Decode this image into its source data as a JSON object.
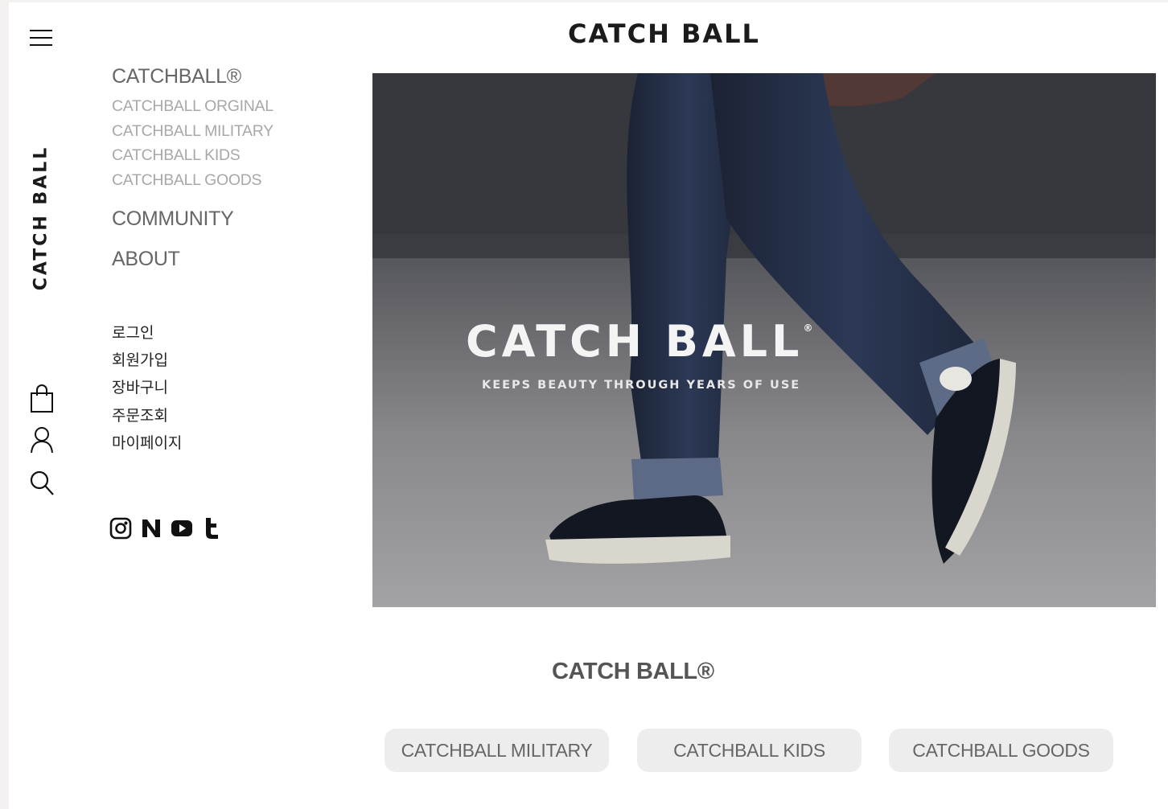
{
  "header": {
    "brand": "CATCH BALL"
  },
  "rail": {
    "logo_text": "CATCH BALL",
    "icons": [
      "menu-icon",
      "shopping-bag-icon",
      "user-icon",
      "search-icon"
    ]
  },
  "menu": {
    "category_title": "CATCHBALL®",
    "sub_items": [
      "CATCHBALL ORGINAL",
      "CATCHBALL MILITARY",
      "CATCHBALL KIDS",
      "CATCHBALL GOODS"
    ],
    "community": "COMMUNITY",
    "about": "ABOUT",
    "account_items": [
      "로그인",
      "회원가입",
      "장바구니",
      "주문조회",
      "마이페이지"
    ],
    "socials": [
      "instagram-icon",
      "naver-blog-icon",
      "youtube-icon",
      "tumblr-icon"
    ]
  },
  "hero": {
    "logo": "CATCH BALL",
    "registered_mark": "®",
    "tagline": "KEEPS BEAUTY THROUGH YEARS OF USE"
  },
  "section": {
    "title": "CATCH BALL®",
    "buttons": [
      "CATCHBALL MILITARY",
      "CATCHBALL KIDS",
      "CATCHBALL GOODS"
    ]
  }
}
